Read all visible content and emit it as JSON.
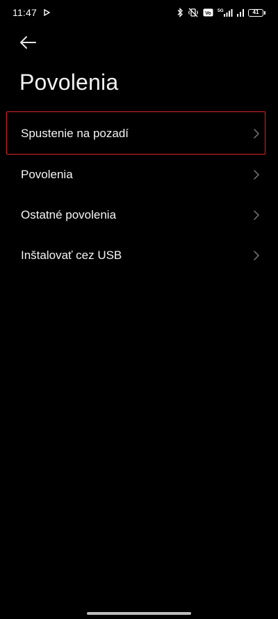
{
  "status_bar": {
    "time": "11:47",
    "battery_level": "41",
    "icons": [
      "play-icon",
      "bluetooth-icon",
      "vibrate-off-icon",
      "volte-icon",
      "5g-signal-icon",
      "signal-bars-icon",
      "battery-icon"
    ],
    "network_label": "5G",
    "volte_label": "Vo"
  },
  "header": {
    "back_icon": "arrow-left-icon",
    "title": "Povolenia"
  },
  "settings": {
    "items": [
      {
        "label": "Spustenie na pozadí",
        "highlighted": true
      },
      {
        "label": "Povolenia",
        "highlighted": false
      },
      {
        "label": "Ostatné povolenia",
        "highlighted": false
      },
      {
        "label": "Inštalovať cez USB",
        "highlighted": false
      }
    ]
  },
  "colors": {
    "background": "#000000",
    "text": "#f5f5f5",
    "chevron": "#7a7a7a",
    "highlight": "#e02424"
  }
}
